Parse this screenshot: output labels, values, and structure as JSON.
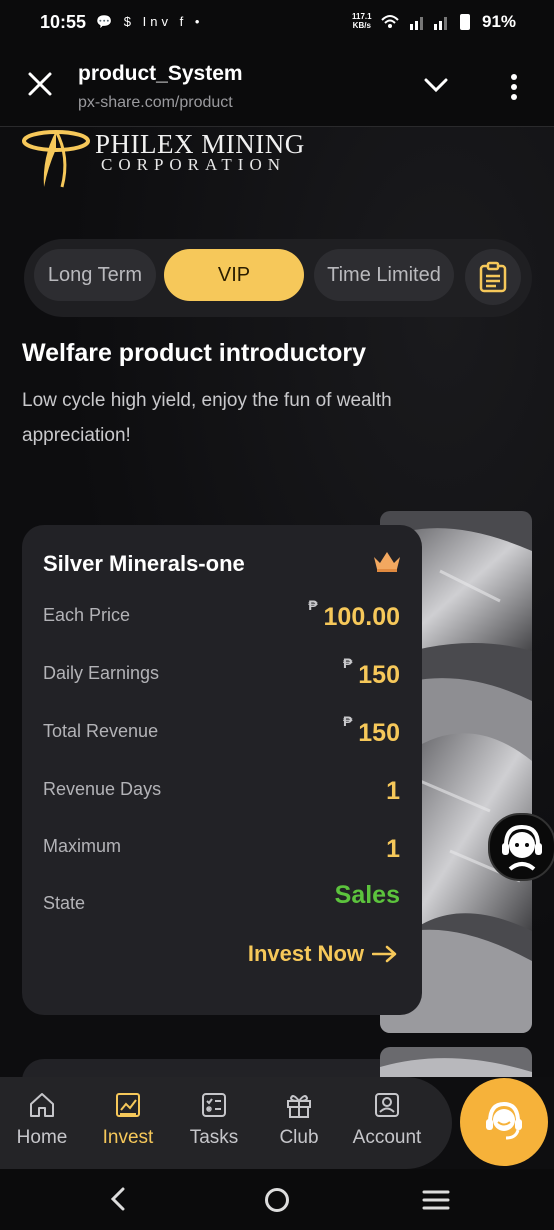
{
  "status_bar": {
    "time": "10:55",
    "notifications": "💬 $ Inv f •",
    "net_speed_value": "117.1",
    "net_speed_unit": "KB/s",
    "battery": "91%"
  },
  "browser": {
    "title": "product_System",
    "url": "px-share.com/product"
  },
  "brand": {
    "line1": "PHILEX MINING",
    "line2": "CORPORATION",
    "accent": "#f6c85a"
  },
  "tabs": [
    {
      "label": "Long Term",
      "active": false
    },
    {
      "label": "VIP",
      "active": true
    },
    {
      "label": "Time Limited",
      "active": false
    }
  ],
  "intro": {
    "heading": "Welfare product introductory",
    "subtitle": "Low cycle high yield, enjoy the fun of wealth appreciation!"
  },
  "product": {
    "name": "Silver Minerals-one",
    "currency_symbol": "₱",
    "rows": [
      {
        "label": "Each Price",
        "value": "100.00",
        "currency": true
      },
      {
        "label": "Daily Earnings",
        "value": "150",
        "currency": true
      },
      {
        "label": "Total Revenue",
        "value": "150",
        "currency": true
      },
      {
        "label": "Revenue Days",
        "value": "1",
        "currency": false
      },
      {
        "label": "Maximum",
        "value": "1",
        "currency": false
      },
      {
        "label": "State",
        "value": "Sales",
        "currency": false
      }
    ],
    "cta": "Invest Now",
    "state_color": "#5cc33d"
  },
  "bottom_nav": [
    {
      "label": "Home",
      "icon": "home-icon",
      "active": false
    },
    {
      "label": "Invest",
      "icon": "invest-icon",
      "active": true
    },
    {
      "label": "Tasks",
      "icon": "tasks-icon",
      "active": false
    },
    {
      "label": "Club",
      "icon": "gift-icon",
      "active": false
    },
    {
      "label": "Account",
      "icon": "account-icon",
      "active": false
    }
  ]
}
